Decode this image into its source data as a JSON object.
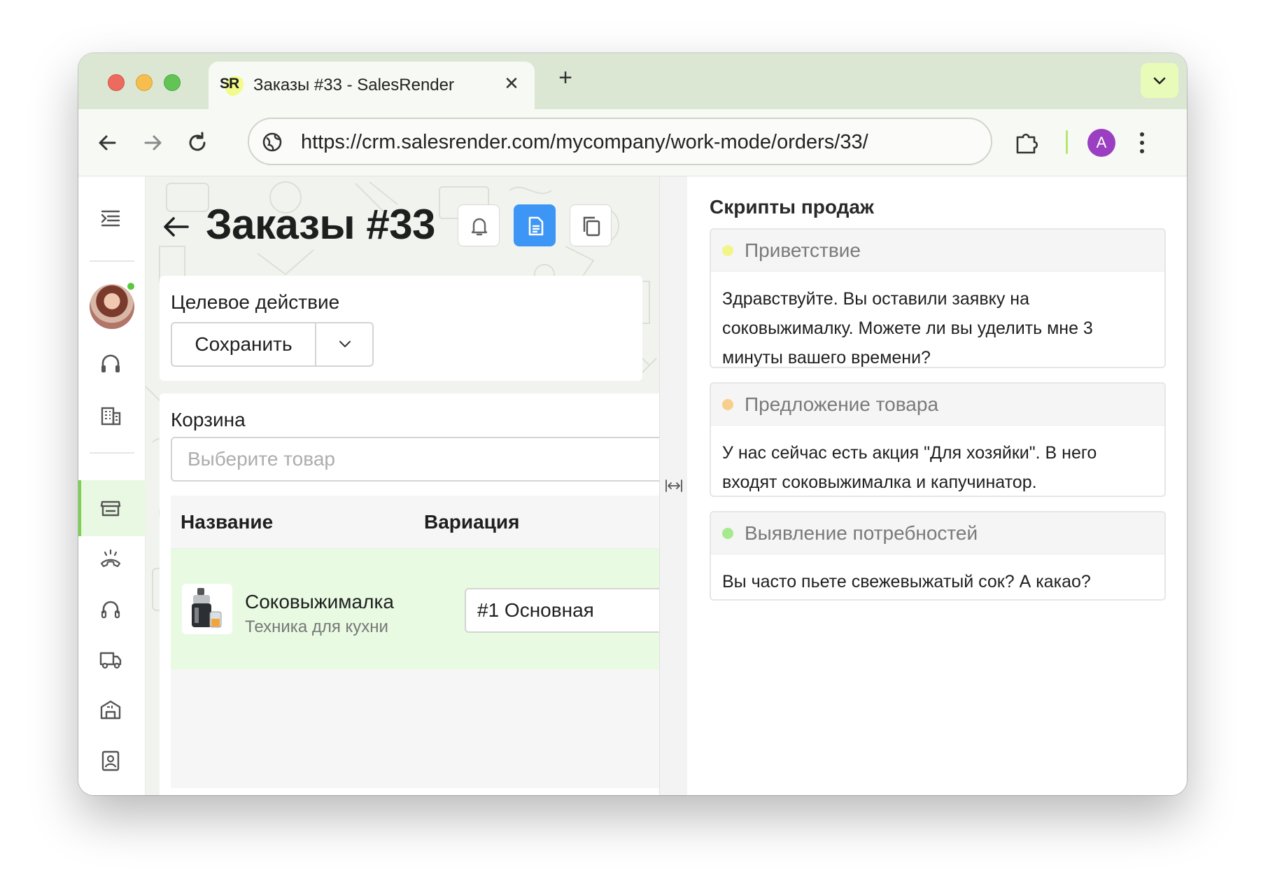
{
  "browser": {
    "tab_title": "Заказы #33 - SalesRender",
    "tab_logo": "SR",
    "close_glyph": "✕",
    "new_tab_glyph": "+",
    "url": "https://crm.salesrender.com/mycompany/work-mode/orders/33/",
    "profile_initial": "A"
  },
  "page": {
    "title": "Заказы #33"
  },
  "target_action": {
    "label": "Целевое действие",
    "button_label": "Сохранить"
  },
  "cart": {
    "label": "Корзина",
    "search_placeholder": "Выберите товар",
    "columns": {
      "name": "Название",
      "variation": "Вариация"
    },
    "rows": [
      {
        "name": "Соковыжималка",
        "category": "Техника для кухни",
        "variation": "#1 Основная"
      }
    ]
  },
  "scripts": {
    "title": "Скрипты продаж",
    "items": [
      {
        "name": "Приветствие",
        "color": "#f2f58a",
        "text": "Здравствуйте. Вы оставили заявку на соковыжималку. Можете ли вы уделить мне 3 минуты вашего времени?"
      },
      {
        "name": "Предложение товара",
        "color": "#f7cf8c",
        "text": "У нас сейчас есть акция \"Для хозяйки\". В него входят соковыжималка и капучинатор."
      },
      {
        "name": "Выявление потребностей",
        "color": "#a6ea8e",
        "text": "Вы часто пьете свежевыжатый сок? А какао?"
      }
    ]
  },
  "colors": {
    "accent_blue": "#3d95f6",
    "active_green": "#7bd14f",
    "tabstrip": "#dbe7d3"
  }
}
